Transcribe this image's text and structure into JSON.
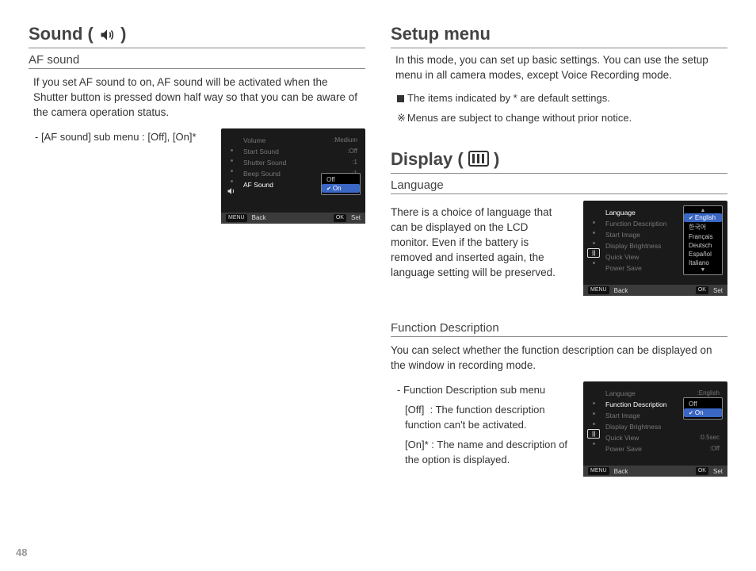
{
  "page_number": "48",
  "left": {
    "title_prefix": "Sound (",
    "title_suffix": " )",
    "sub_af_sound": "AF sound",
    "af_para": "If you set AF sound to on, AF sound will be activated when the Shutter button is pressed down half way so that you can be aware of the camera operation status.",
    "af_submenu_line": "- [AF sound] sub menu : [Off], [On]*",
    "lcd": {
      "rows": [
        {
          "label": "Volume",
          "val": ":Medium"
        },
        {
          "label": "Start Sound",
          "val": ":Off"
        },
        {
          "label": "Shutter Sound",
          "val": ":1"
        },
        {
          "label": "Beep Sound",
          "val": ":1"
        },
        {
          "label": "AF Sound",
          "val": ""
        }
      ],
      "popup_off": "Off",
      "popup_on": "On",
      "footer_menu": "MENU",
      "footer_back": "Back",
      "footer_ok": "OK",
      "footer_set": "Set"
    }
  },
  "right": {
    "setup_title": "Setup menu",
    "setup_para": "In this mode, you can set up basic settings. You can use the setup menu in all camera modes, except Voice Recording mode.",
    "bullet_default": "The items indicated by * are default settings.",
    "bullet_notice": "Menus are subject to change without prior notice.",
    "display_title_prefix": "Display (",
    "display_title_suffix": " )",
    "lang_head": "Language",
    "lang_para": "There is a choice of language that can be displayed on the LCD monitor. Even if the battery is removed and inserted again, the language setting will be preserved.",
    "lang_lcd": {
      "rows": [
        {
          "label": "Language",
          "val": ""
        },
        {
          "label": "Function Description",
          "val": ""
        },
        {
          "label": "Start Image",
          "val": ""
        },
        {
          "label": "Display Brightness",
          "val": ""
        },
        {
          "label": "Quick View",
          "val": ""
        },
        {
          "label": "Power Save",
          "val": ""
        }
      ],
      "options": [
        "English",
        "한국어",
        "Français",
        "Deutsch",
        "Español",
        "Italiano"
      ],
      "footer_menu": "MENU",
      "footer_back": "Back",
      "footer_ok": "OK",
      "footer_set": "Set"
    },
    "fd_head": "Function Description",
    "fd_para": "You can select whether the function description can be displayed on the window in recording mode.",
    "fd_sub_title": "- Function Description sub menu",
    "fd_off_label": "[Off]",
    "fd_off_sep": ":",
    "fd_off_text": "The function description function can't be activated.",
    "fd_on_label": "[On]*",
    "fd_on_sep": ":",
    "fd_on_text": "The name and description of the option is displayed.",
    "fd_lcd": {
      "rows": [
        {
          "label": "Language",
          "val": ":English"
        },
        {
          "label": "Function Description",
          "val": ""
        },
        {
          "label": "Start Image",
          "val": ""
        },
        {
          "label": "Display Brightness",
          "val": ""
        },
        {
          "label": "Quick View",
          "val": ":0.5sec"
        },
        {
          "label": "Power Save",
          "val": ":Off"
        }
      ],
      "popup_off": "Off",
      "popup_on": "On",
      "footer_menu": "MENU",
      "footer_back": "Back",
      "footer_ok": "OK",
      "footer_set": "Set"
    }
  }
}
